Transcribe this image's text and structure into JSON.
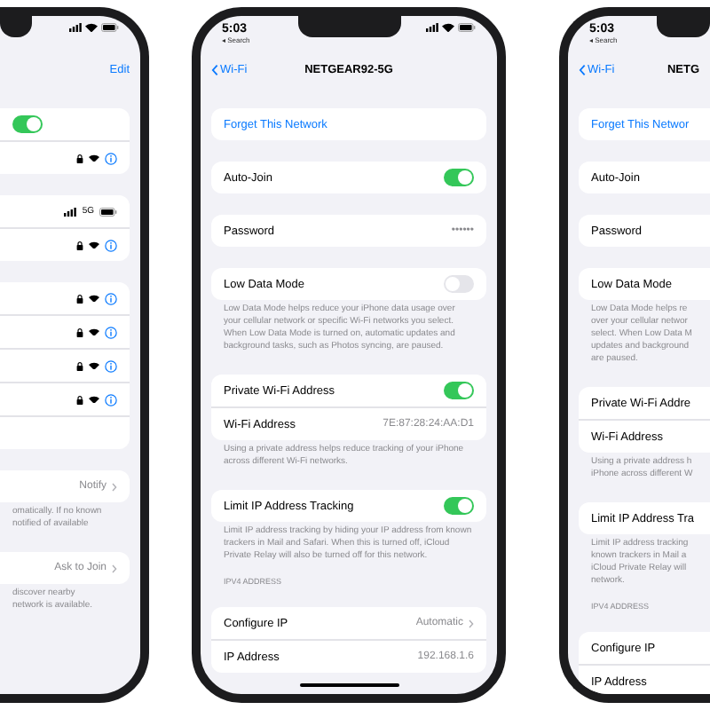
{
  "phones": [
    {
      "cut_left": true,
      "cut_right": false,
      "nav": {
        "action": "Edit"
      },
      "blocks": [
        {
          "kind": "card",
          "rows": [
            {
              "kind": "toggle",
              "on": true
            },
            {
              "kind": "network"
            }
          ]
        },
        {
          "kind": "card",
          "rows": [
            {
              "kind": "cellular",
              "value": "5G"
            },
            {
              "kind": "network"
            }
          ]
        },
        {
          "kind": "card",
          "rows": [
            {
              "kind": "network"
            },
            {
              "kind": "network"
            },
            {
              "kind": "network"
            },
            {
              "kind": "network"
            },
            {
              "kind": "blank"
            }
          ]
        },
        {
          "kind": "card",
          "rows": [
            {
              "kind": "menu",
              "value": "Notify"
            }
          ]
        },
        {
          "kind": "note",
          "lines": [
            "omatically. If no known",
            "notified of available"
          ]
        },
        {
          "kind": "card",
          "rows": [
            {
              "kind": "menu",
              "value": "Ask to Join"
            }
          ]
        },
        {
          "kind": "note",
          "lines": [
            "discover nearby",
            "network is available."
          ]
        }
      ]
    },
    {
      "cut_left": false,
      "cut_right": false,
      "status": {
        "time": "5:03",
        "back": "◂ Search"
      },
      "nav": {
        "back": "Wi-Fi",
        "title": "NETGEAR92-5G"
      },
      "blocks": [
        {
          "kind": "card",
          "rows": [
            {
              "kind": "link",
              "label": "Forget This Network"
            }
          ]
        },
        {
          "kind": "card",
          "rows": [
            {
              "kind": "toggle",
              "label": "Auto-Join",
              "on": true
            }
          ]
        },
        {
          "kind": "card",
          "rows": [
            {
              "kind": "value",
              "label": "Password",
              "value": "••••••"
            }
          ]
        },
        {
          "kind": "card",
          "rows": [
            {
              "kind": "toggle",
              "label": "Low Data Mode",
              "on": false
            }
          ]
        },
        {
          "kind": "note",
          "text": "Low Data Mode helps reduce your iPhone data usage over your cellular network or specific Wi-Fi networks you select. When Low Data Mode is turned on, automatic updates and background tasks, such as Photos syncing, are paused."
        },
        {
          "kind": "card",
          "rows": [
            {
              "kind": "toggle",
              "label": "Private Wi-Fi Address",
              "on": true
            },
            {
              "kind": "value",
              "label": "Wi-Fi Address",
              "value": "7E:87:28:24:AA:D1"
            }
          ]
        },
        {
          "kind": "note",
          "text": "Using a private address helps reduce tracking of your iPhone across different Wi-Fi networks."
        },
        {
          "kind": "card",
          "rows": [
            {
              "kind": "toggle",
              "label": "Limit IP Address Tracking",
              "on": true
            }
          ]
        },
        {
          "kind": "note",
          "text": "Limit IP address tracking by hiding your IP address from known trackers in Mail and Safari. When this is turned off, iCloud Private Relay will also be turned off for this network."
        },
        {
          "kind": "header",
          "text": "IPV4 ADDRESS"
        },
        {
          "kind": "card",
          "rows": [
            {
              "kind": "menu",
              "label": "Configure IP",
              "value": "Automatic"
            },
            {
              "kind": "value",
              "label": "IP Address",
              "value": "192.168.1.6"
            }
          ]
        }
      ]
    },
    {
      "cut_left": false,
      "cut_right": true,
      "status": {
        "time": "5:03",
        "back": "◂ Search"
      },
      "nav": {
        "back": "Wi-Fi",
        "title": "NETG"
      },
      "blocks": [
        {
          "kind": "card",
          "rows": [
            {
              "kind": "link",
              "label": "Forget This Networ"
            }
          ]
        },
        {
          "kind": "card",
          "rows": [
            {
              "kind": "label",
              "label": "Auto-Join"
            }
          ]
        },
        {
          "kind": "card",
          "rows": [
            {
              "kind": "label",
              "label": "Password"
            }
          ]
        },
        {
          "kind": "card",
          "rows": [
            {
              "kind": "label",
              "label": "Low Data Mode"
            }
          ]
        },
        {
          "kind": "note",
          "lines": [
            "Low Data Mode helps re",
            "over your cellular networ",
            "select. When Low Data M",
            "updates and background",
            "are paused."
          ]
        },
        {
          "kind": "card",
          "rows": [
            {
              "kind": "label",
              "label": "Private Wi-Fi Addre"
            },
            {
              "kind": "label",
              "label": "Wi-Fi Address"
            }
          ]
        },
        {
          "kind": "note",
          "lines": [
            "Using a private address h",
            "iPhone across different W"
          ]
        },
        {
          "kind": "card",
          "rows": [
            {
              "kind": "label",
              "label": "Limit IP Address Tra"
            }
          ]
        },
        {
          "kind": "note",
          "lines": [
            "Limit IP address tracking",
            "known trackers in Mail a",
            "iCloud Private Relay will",
            "network."
          ]
        },
        {
          "kind": "header",
          "text": "IPV4 ADDRESS"
        },
        {
          "kind": "card",
          "rows": [
            {
              "kind": "label",
              "label": "Configure IP"
            },
            {
              "kind": "label",
              "label": "IP Address"
            }
          ]
        }
      ]
    }
  ]
}
